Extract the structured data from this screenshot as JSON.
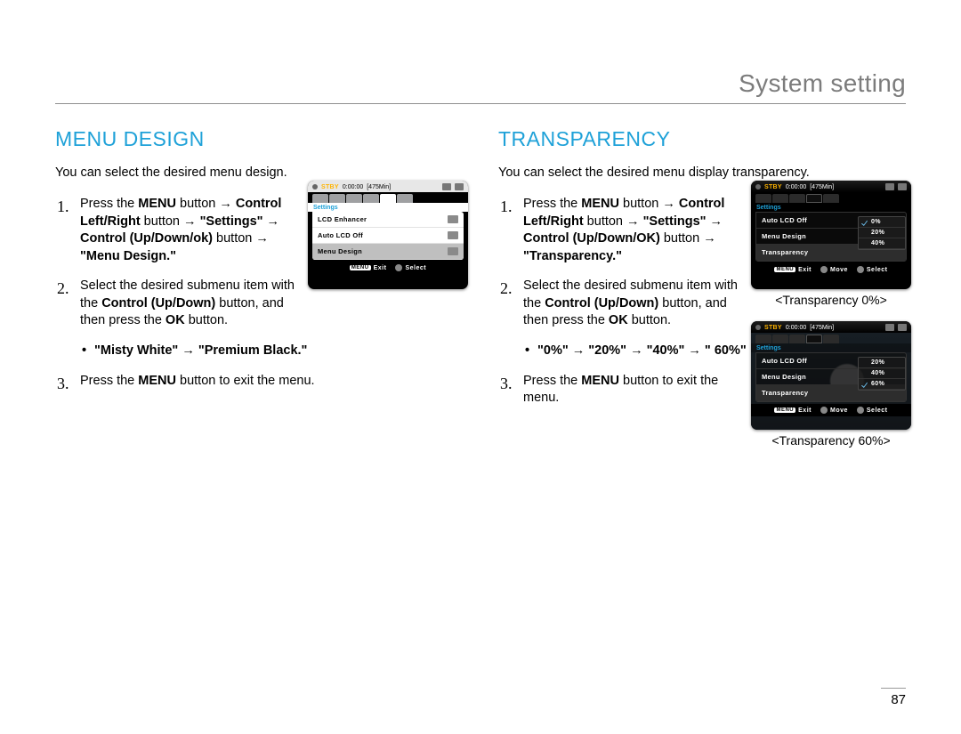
{
  "header": {
    "section": "System setting"
  },
  "page_number": "87",
  "left": {
    "title": "MENU DESIGN",
    "intro": "You can select the desired menu design.",
    "step1_a": "Press the ",
    "step1_b": "MENU",
    "step1_c": " button → ",
    "step1_d": "Control Left/Right",
    "step1_e": " button → ",
    "step1_f": "\"Settings\"",
    "step1_g": " → ",
    "step1_h": "Control (Up/Down/ok)",
    "step1_i": " button → ",
    "step1_j": "\"Menu Design.\"",
    "step2_a": "Select the desired submenu item with the ",
    "step2_b": "Control (Up/Down)",
    "step2_c": " button, and then press the ",
    "step2_d": "OK",
    "step2_e": " button.",
    "bullet1": "\"Misty White\" → \"Premium Black.\"",
    "step3_a": "Press the ",
    "step3_b": "MENU",
    "step3_c": " button to exit the menu.",
    "lcd": {
      "stby": "STBY",
      "time": "0:00:00",
      "remain": "[475Min]",
      "settings": "Settings",
      "rows": [
        "LCD Enhancer",
        "Auto LCD Off",
        "Menu Design"
      ],
      "bb_menu": "MENU",
      "bb_exit": "Exit",
      "bb_select": "Select"
    }
  },
  "right": {
    "title": "TRANSPARENCY",
    "intro": "You can select the desired menu display transparency.",
    "step1_a": "Press the ",
    "step1_b": "MENU",
    "step1_c": " button → ",
    "step1_d": "Control Left/Right",
    "step1_e": " button → ",
    "step1_f": "\"Settings\"",
    "step1_g": " → ",
    "step1_h": "Control (Up/Down/OK)",
    "step1_i": " button → ",
    "step1_j": "\"Transparency.\"",
    "step2_a": "Select the desired submenu item with the ",
    "step2_b": "Control (Up/Down)",
    "step2_c": " button, and then press the ",
    "step2_d": "OK",
    "step2_e": " button.",
    "bullet1": "\"0%\" → \"20%\" → \"40%\" → \" 60%\"",
    "step3_a": "Press the ",
    "step3_b": "MENU",
    "step3_c": " button to exit the menu.",
    "lcd1": {
      "stby": "STBY",
      "time": "0:00:00",
      "remain": "[475Min]",
      "settings": "Settings",
      "rows": [
        "Auto LCD Off",
        "Menu Design",
        "Transparency"
      ],
      "opts": [
        "0%",
        "20%",
        "40%"
      ],
      "bb_menu": "MENU",
      "bb_exit": "Exit",
      "bb_move": "Move",
      "bb_select": "Select",
      "caption": "<Transparency 0%>"
    },
    "lcd2": {
      "stby": "STBY",
      "time": "0:00:00",
      "remain": "[475Min]",
      "settings": "Settings",
      "rows": [
        "Auto LCD Off",
        "Menu Design",
        "Transparency"
      ],
      "opts": [
        "20%",
        "40%",
        "60%"
      ],
      "bb_menu": "MENU",
      "bb_exit": "Exit",
      "bb_move": "Move",
      "bb_select": "Select",
      "caption": "<Transparency 60%>"
    }
  }
}
